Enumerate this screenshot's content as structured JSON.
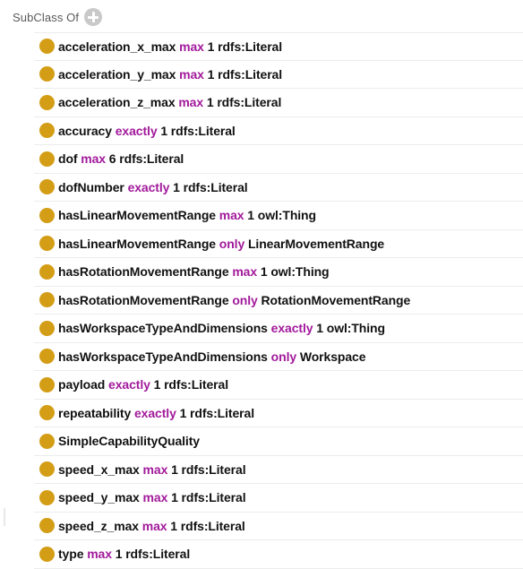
{
  "section": {
    "title": "SubClass Of",
    "add_icon": "plus-circle-icon"
  },
  "colors": {
    "keyword": "#a21a9b",
    "property_dot": "#d49d16",
    "text": "#111111"
  },
  "items": [
    {
      "property": "acceleration_x_max",
      "restriction": "max",
      "filler": "1 rdfs:Literal"
    },
    {
      "property": "acceleration_y_max",
      "restriction": "max",
      "filler": "1 rdfs:Literal"
    },
    {
      "property": "acceleration_z_max",
      "restriction": "max",
      "filler": "1 rdfs:Literal"
    },
    {
      "property": "accuracy",
      "restriction": "exactly",
      "filler": "1 rdfs:Literal"
    },
    {
      "property": "dof",
      "restriction": "max",
      "filler": "6 rdfs:Literal"
    },
    {
      "property": "dofNumber",
      "restriction": "exactly",
      "filler": "1 rdfs:Literal"
    },
    {
      "property": "hasLinearMovementRange",
      "restriction": "max",
      "filler": "1 owl:Thing"
    },
    {
      "property": "hasLinearMovementRange",
      "restriction": "only",
      "filler": "LinearMovementRange"
    },
    {
      "property": "hasRotationMovementRange",
      "restriction": "max",
      "filler": "1 owl:Thing"
    },
    {
      "property": "hasRotationMovementRange",
      "restriction": "only",
      "filler": "RotationMovementRange"
    },
    {
      "property": "hasWorkspaceTypeAndDimensions",
      "restriction": "exactly",
      "filler": "1 owl:Thing"
    },
    {
      "property": "hasWorkspaceTypeAndDimensions",
      "restriction": "only",
      "filler": "Workspace"
    },
    {
      "property": "payload",
      "restriction": "exactly",
      "filler": "1 rdfs:Literal"
    },
    {
      "property": "repeatability",
      "restriction": "exactly",
      "filler": "1 rdfs:Literal"
    },
    {
      "property": "SimpleCapabilityQuality",
      "restriction": "",
      "filler": ""
    },
    {
      "property": "speed_x_max",
      "restriction": "max",
      "filler": "1 rdfs:Literal"
    },
    {
      "property": "speed_y_max",
      "restriction": "max",
      "filler": "1 rdfs:Literal"
    },
    {
      "property": "speed_z_max",
      "restriction": "max",
      "filler": "1 rdfs:Literal"
    },
    {
      "property": "type",
      "restriction": "max",
      "filler": "1 rdfs:Literal"
    }
  ]
}
